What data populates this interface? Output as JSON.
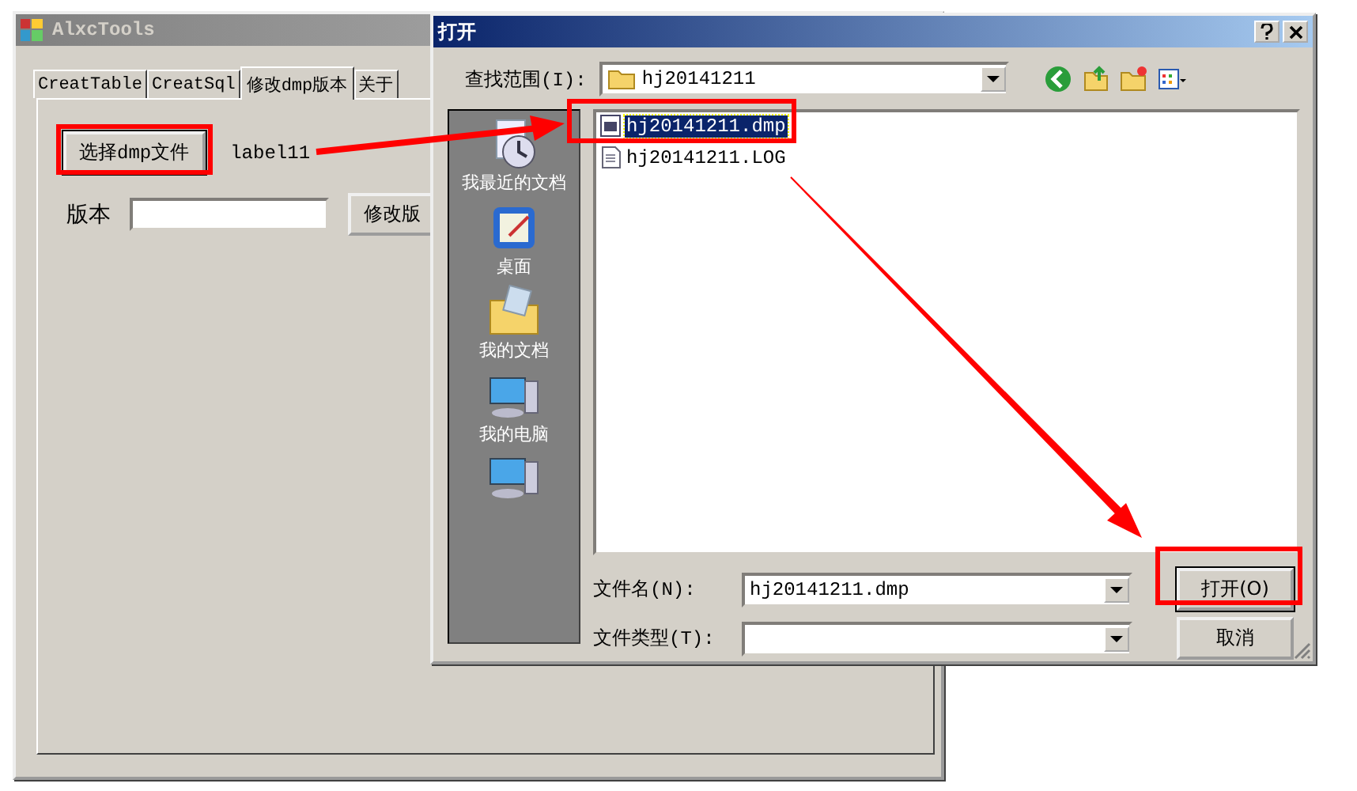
{
  "main_window": {
    "title": "AlxcTools",
    "tabs": [
      {
        "label": "CreatTable",
        "selected": false
      },
      {
        "label": "CreatSql",
        "selected": false
      },
      {
        "label": "修改dmp版本",
        "selected": true
      },
      {
        "label": "关于",
        "selected": false
      }
    ],
    "select_button": "选择dmp文件",
    "status_label": "label11",
    "version_label": "版本",
    "modify_button": "修改版"
  },
  "dialog": {
    "title": "打开",
    "look_in_label": "查找范围(I):",
    "look_in_value": "hj20141211",
    "places": [
      {
        "label": "我最近的文档",
        "kind": "recent"
      },
      {
        "label": "桌面",
        "kind": "desktop"
      },
      {
        "label": "我的文档",
        "kind": "documents"
      },
      {
        "label": "我的电脑",
        "kind": "computer"
      },
      {
        "kind": "network"
      }
    ],
    "files": [
      {
        "name": "hj20141211.dmp",
        "kind": "dmp",
        "selected": true
      },
      {
        "name": "hj20141211.LOG",
        "kind": "log",
        "selected": false
      }
    ],
    "file_name_label": "文件名(N):",
    "file_name_value": "hj20141211.dmp",
    "file_type_label": "文件类型(T):",
    "open_button": "打开(O)",
    "cancel_button": "取消"
  }
}
